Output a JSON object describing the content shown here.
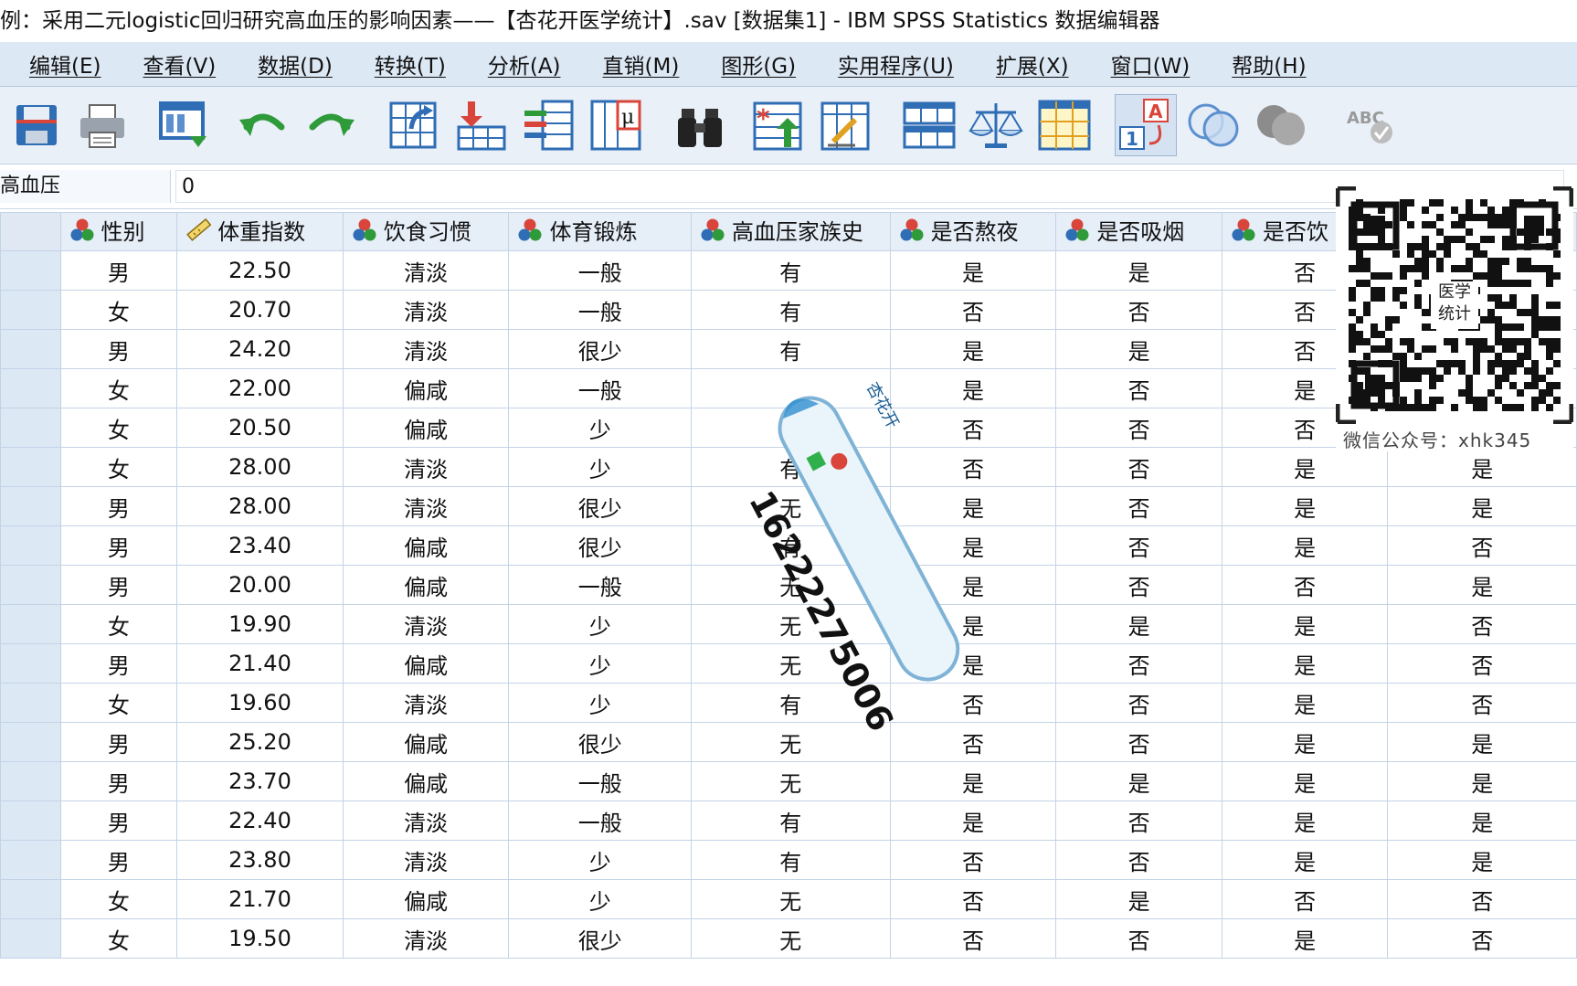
{
  "window": {
    "title": "例：采用二元logistic回归研究高血压的影响因素——【杏花开医学统计】.sav [数据集1] - IBM SPSS Statistics 数据编辑器"
  },
  "menu": [
    {
      "label": "编辑(E)"
    },
    {
      "label": "查看(V)"
    },
    {
      "label": "数据(D)"
    },
    {
      "label": "转换(T)"
    },
    {
      "label": "分析(A)"
    },
    {
      "label": "直销(M)"
    },
    {
      "label": "图形(G)"
    },
    {
      "label": "实用程序(U)"
    },
    {
      "label": "扩展(X)"
    },
    {
      "label": "窗口(W)"
    },
    {
      "label": "帮助(H)"
    }
  ],
  "toolbar": {
    "icons": [
      "save-icon",
      "print-icon",
      "recall-dialog-icon",
      "undo-icon",
      "redo-icon",
      "go-to-case-icon",
      "go-to-variable-icon",
      "variables-icon",
      "descriptives-icon",
      "find-icon",
      "insert-cases-icon",
      "insert-variable-icon",
      "split-file-icon",
      "weight-cases-icon",
      "select-cases-icon",
      "value-labels-icon",
      "use-sets-icon",
      "show-all-variables-icon",
      "spell-check-icon"
    ]
  },
  "cell_editor": {
    "variable": "高血压",
    "value": "0"
  },
  "grid": {
    "columns": [
      {
        "label": "性别",
        "type": "nominal"
      },
      {
        "label": "体重指数",
        "type": "scale"
      },
      {
        "label": "饮食习惯",
        "type": "nominal"
      },
      {
        "label": "体育锻炼",
        "type": "nominal"
      },
      {
        "label": "高血压家族史",
        "type": "nominal"
      },
      {
        "label": "是否熬夜",
        "type": "nominal"
      },
      {
        "label": "是否吸烟",
        "type": "nominal"
      },
      {
        "label": "是否饮",
        "type": "nominal"
      },
      {
        "label": "",
        "type": "nominal"
      }
    ],
    "rows": [
      [
        "男",
        "22.50",
        "清淡",
        "一般",
        "有",
        "是",
        "是",
        "否",
        ""
      ],
      [
        "女",
        "20.70",
        "清淡",
        "一般",
        "有",
        "否",
        "否",
        "否",
        ""
      ],
      [
        "男",
        "24.20",
        "清淡",
        "很少",
        "有",
        "是",
        "是",
        "否",
        ""
      ],
      [
        "女",
        "22.00",
        "偏咸",
        "一般",
        "",
        "是",
        "否",
        "是",
        ""
      ],
      [
        "女",
        "20.50",
        "偏咸",
        "少",
        "",
        "否",
        "否",
        "否",
        "是"
      ],
      [
        "女",
        "28.00",
        "清淡",
        "少",
        "有",
        "否",
        "否",
        "是",
        "是"
      ],
      [
        "男",
        "28.00",
        "清淡",
        "很少",
        "无",
        "是",
        "否",
        "是",
        "是"
      ],
      [
        "男",
        "23.40",
        "偏咸",
        "很少",
        "有",
        "是",
        "否",
        "是",
        "否"
      ],
      [
        "男",
        "20.00",
        "偏咸",
        "一般",
        "无",
        "是",
        "否",
        "否",
        "是"
      ],
      [
        "女",
        "19.90",
        "清淡",
        "少",
        "无",
        "是",
        "是",
        "是",
        "否"
      ],
      [
        "男",
        "21.40",
        "偏咸",
        "少",
        "无",
        "是",
        "否",
        "是",
        "否"
      ],
      [
        "女",
        "19.60",
        "清淡",
        "少",
        "有",
        "否",
        "否",
        "是",
        "否"
      ],
      [
        "男",
        "25.20",
        "偏咸",
        "很少",
        "无",
        "否",
        "否",
        "是",
        "是"
      ],
      [
        "男",
        "23.70",
        "偏咸",
        "一般",
        "无",
        "是",
        "是",
        "是",
        "是"
      ],
      [
        "男",
        "22.40",
        "清淡",
        "一般",
        "有",
        "是",
        "否",
        "是",
        "是"
      ],
      [
        "男",
        "23.80",
        "清淡",
        "少",
        "有",
        "否",
        "否",
        "是",
        "是"
      ],
      [
        "女",
        "21.70",
        "偏咸",
        "少",
        "无",
        "否",
        "是",
        "否",
        "否"
      ],
      [
        "女",
        "19.50",
        "清淡",
        "很少",
        "无",
        "否",
        "否",
        "是",
        "否"
      ]
    ]
  },
  "watermark": {
    "qr_caption": "微信公众号：xhk345",
    "qr_center_text": "医学统计",
    "sticker_number": "16222275006",
    "sticker_text": "杏花开"
  },
  "colors": {
    "menubar": "#dde8f5",
    "toolbar": "#e9f0f8",
    "grid_header": "#e6eef8",
    "row_header": "#dde8f5",
    "grid_line": "#c3d3e6"
  }
}
